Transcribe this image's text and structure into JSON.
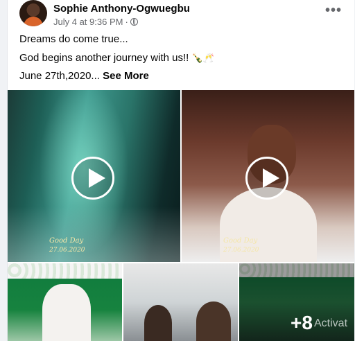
{
  "post": {
    "author": "Sophie Anthony-Ogwuegbu",
    "timestamp": "July 4 at 9:36 PM",
    "dot": "·",
    "more_label": "•••",
    "text_line1": "Dreams do come true...",
    "text_line2": "God begins another journey with us!!",
    "text_line2_emoji": "🍾🥂",
    "text_line3": "June 27th,2020...",
    "see_more": "See More"
  },
  "media": {
    "watermark_line1": "Good Day",
    "watermark_line2": "27.06.2020",
    "extra_count": "+8",
    "overlay_text": "Activat"
  },
  "icons": {
    "privacy": "globe-icon",
    "options": "more-icon",
    "play": "play-icon"
  }
}
